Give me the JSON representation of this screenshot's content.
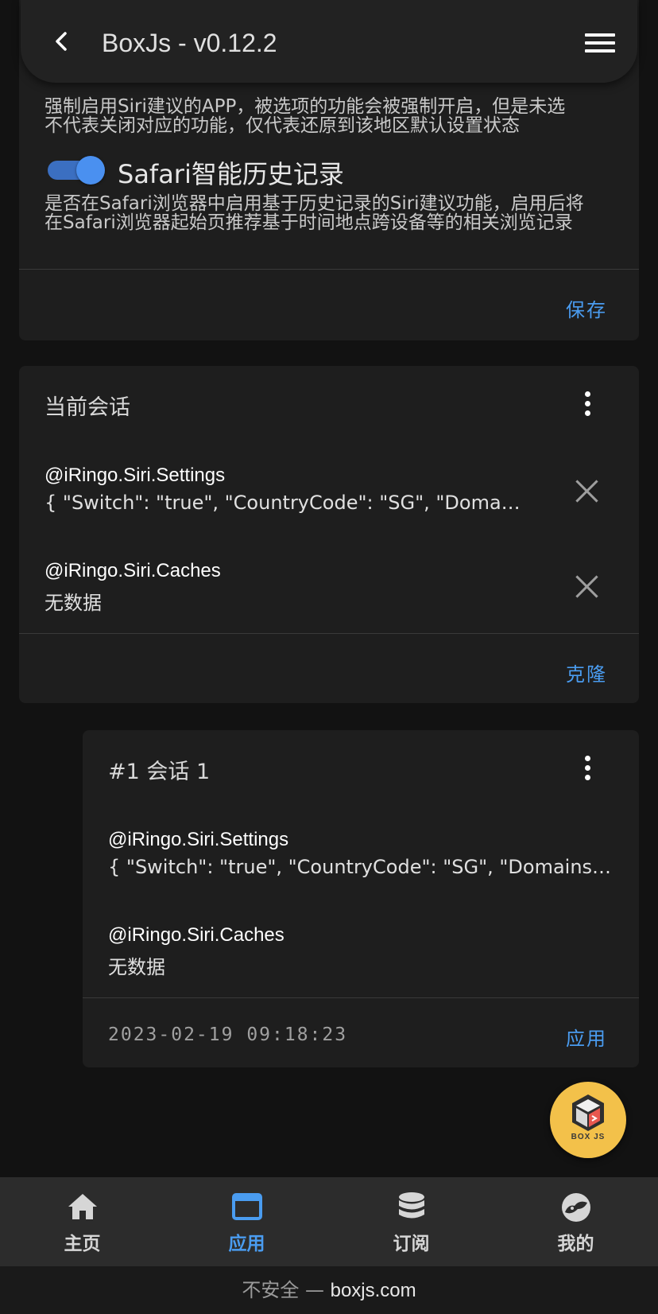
{
  "appbar": {
    "title": "BoxJs - v0.12.2"
  },
  "settings": {
    "desc_top_line1": "强制启用Siri建议的APP，被选项的功能会被强制开启，但是未选",
    "desc_top_line2": "不代表关闭对应的功能，仅代表还原到该地区默认设置状态",
    "safari_switch_label": "Safari智能历史记录",
    "safari_switch_on": true,
    "safari_desc_line1": "是否在Safari浏览器中启用基于历史记录的Siri建议功能，启用后将",
    "safari_desc_line2": "在Safari浏览器起始页推荐基于时间地点跨设备等的相关浏览记录",
    "save_label": "保存"
  },
  "current_session": {
    "title": "当前会话",
    "items": [
      {
        "key": "@iRingo.Siri.Settings",
        "value": "{ \"Switch\": \"true\", \"CountryCode\": \"SG\", \"Domains\": \"..."
      },
      {
        "key": "@iRingo.Siri.Caches",
        "value": "无数据"
      }
    ],
    "clone_label": "克隆"
  },
  "saved_session": {
    "title": "#1 会话 1",
    "items": [
      {
        "key": "@iRingo.Siri.Settings",
        "value": "{ \"Switch\": \"true\", \"CountryCode\": \"SG\", \"Domains\": \"we..."
      },
      {
        "key": "@iRingo.Siri.Caches",
        "value": "无数据"
      }
    ],
    "timestamp": "2023-02-19 09:18:23",
    "apply_label": "应用"
  },
  "fab": {
    "logo_text": "BOX JS"
  },
  "bottom_nav": [
    {
      "label": "主页",
      "icon": "home-icon",
      "active": false
    },
    {
      "label": "应用",
      "icon": "app-window-icon",
      "active": true
    },
    {
      "label": "订阅",
      "icon": "database-icon",
      "active": false
    },
    {
      "label": "我的",
      "icon": "profile-icon",
      "active": false
    }
  ],
  "url_bar": {
    "insecure_label": "不安全 — ",
    "domain": "boxjs.com"
  },
  "colors": {
    "accent": "#4a9cf0",
    "background": "#121212",
    "card": "#1e1e1e",
    "fab": "#f3c14a"
  }
}
